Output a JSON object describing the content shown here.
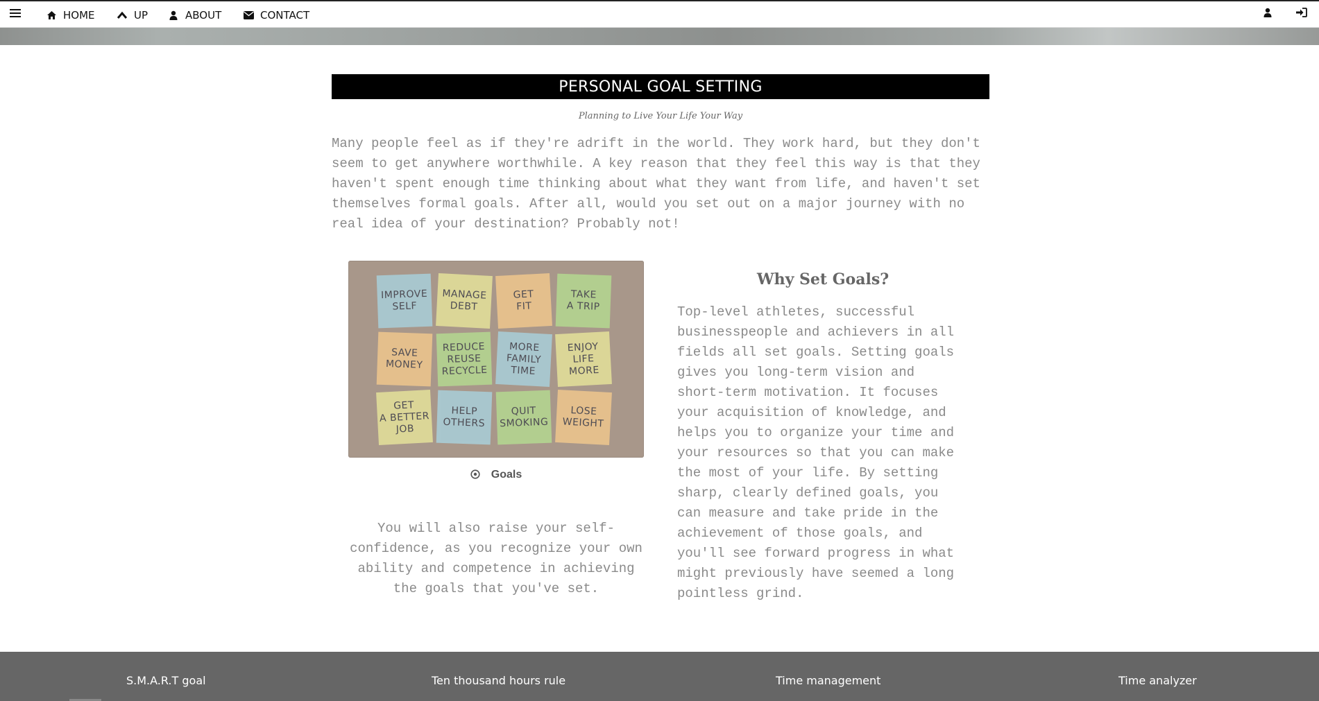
{
  "nav": {
    "items": [
      {
        "label": "HOME",
        "icon": "home-icon"
      },
      {
        "label": "UP",
        "icon": "chevron-up-icon"
      },
      {
        "label": "ABOUT",
        "icon": "user-icon"
      },
      {
        "label": "CONTACT",
        "icon": "envelope-icon"
      }
    ],
    "right_icons": [
      "user-icon",
      "sign-in-icon"
    ]
  },
  "page": {
    "title": "PERSONAL GOAL SETTING",
    "subtitle": "Planning to Live Your Life Your Way",
    "intro": "Many people feel as if they're adrift in the world. They work hard, but they don't seem to get anywhere worthwhile. A key reason that they feel this way is that they haven't spent enough time thinking about what they want from life, and haven't set themselves formal goals. After all, would you set out on a major journey with no real idea of your destination? Probably not!"
  },
  "image": {
    "notes": [
      {
        "text": "IMPROVE\nSELF",
        "color": "#a9cfd9"
      },
      {
        "text": "MANAGE\nDEBT",
        "color": "#e4e19a"
      },
      {
        "text": "GET\nFIT",
        "color": "#efc78d"
      },
      {
        "text": "TAKE\nA TRIP",
        "color": "#b4d890"
      },
      {
        "text": "SAVE\nMONEY",
        "color": "#efc78d"
      },
      {
        "text": "REDUCE\nREUSE\nRECYCLE",
        "color": "#b4d890"
      },
      {
        "text": "MORE\nFAMILY\nTIME",
        "color": "#a9cfd9"
      },
      {
        "text": "ENJOY\nLIFE\nMORE",
        "color": "#e4e19a"
      },
      {
        "text": "GET\nA BETTER\nJOB",
        "color": "#e4e19a"
      },
      {
        "text": "HELP\nOTHERS",
        "color": "#a9cfd9"
      },
      {
        "text": "QUIT\nSMOKING",
        "color": "#b4d890"
      },
      {
        "text": "LOSE\nWEIGHT",
        "color": "#efc78d"
      }
    ],
    "caption": "Goals"
  },
  "left_para": "You will also raise your self-confidence, as you recognize your own ability and competence in achieving the goals that you've set.",
  "right": {
    "heading": "Why Set Goals?",
    "para": "Top-level athletes, successful businesspeople and achievers in all fields all set goals. Setting goals gives you long-term vision and short-term motivation. It focuses your acquisition of knowledge, and helps you to organize your time and your resources so that you can make the most of your life. By setting sharp, clearly defined goals, you can measure and take pride in the achievement of those goals, and you'll see forward progress in what might previously have seemed a long pointless grind."
  },
  "footer": {
    "links": [
      "S.M.A.R.T goal",
      "Ten thousand hours rule",
      "Time management",
      "Time analyzer"
    ]
  }
}
